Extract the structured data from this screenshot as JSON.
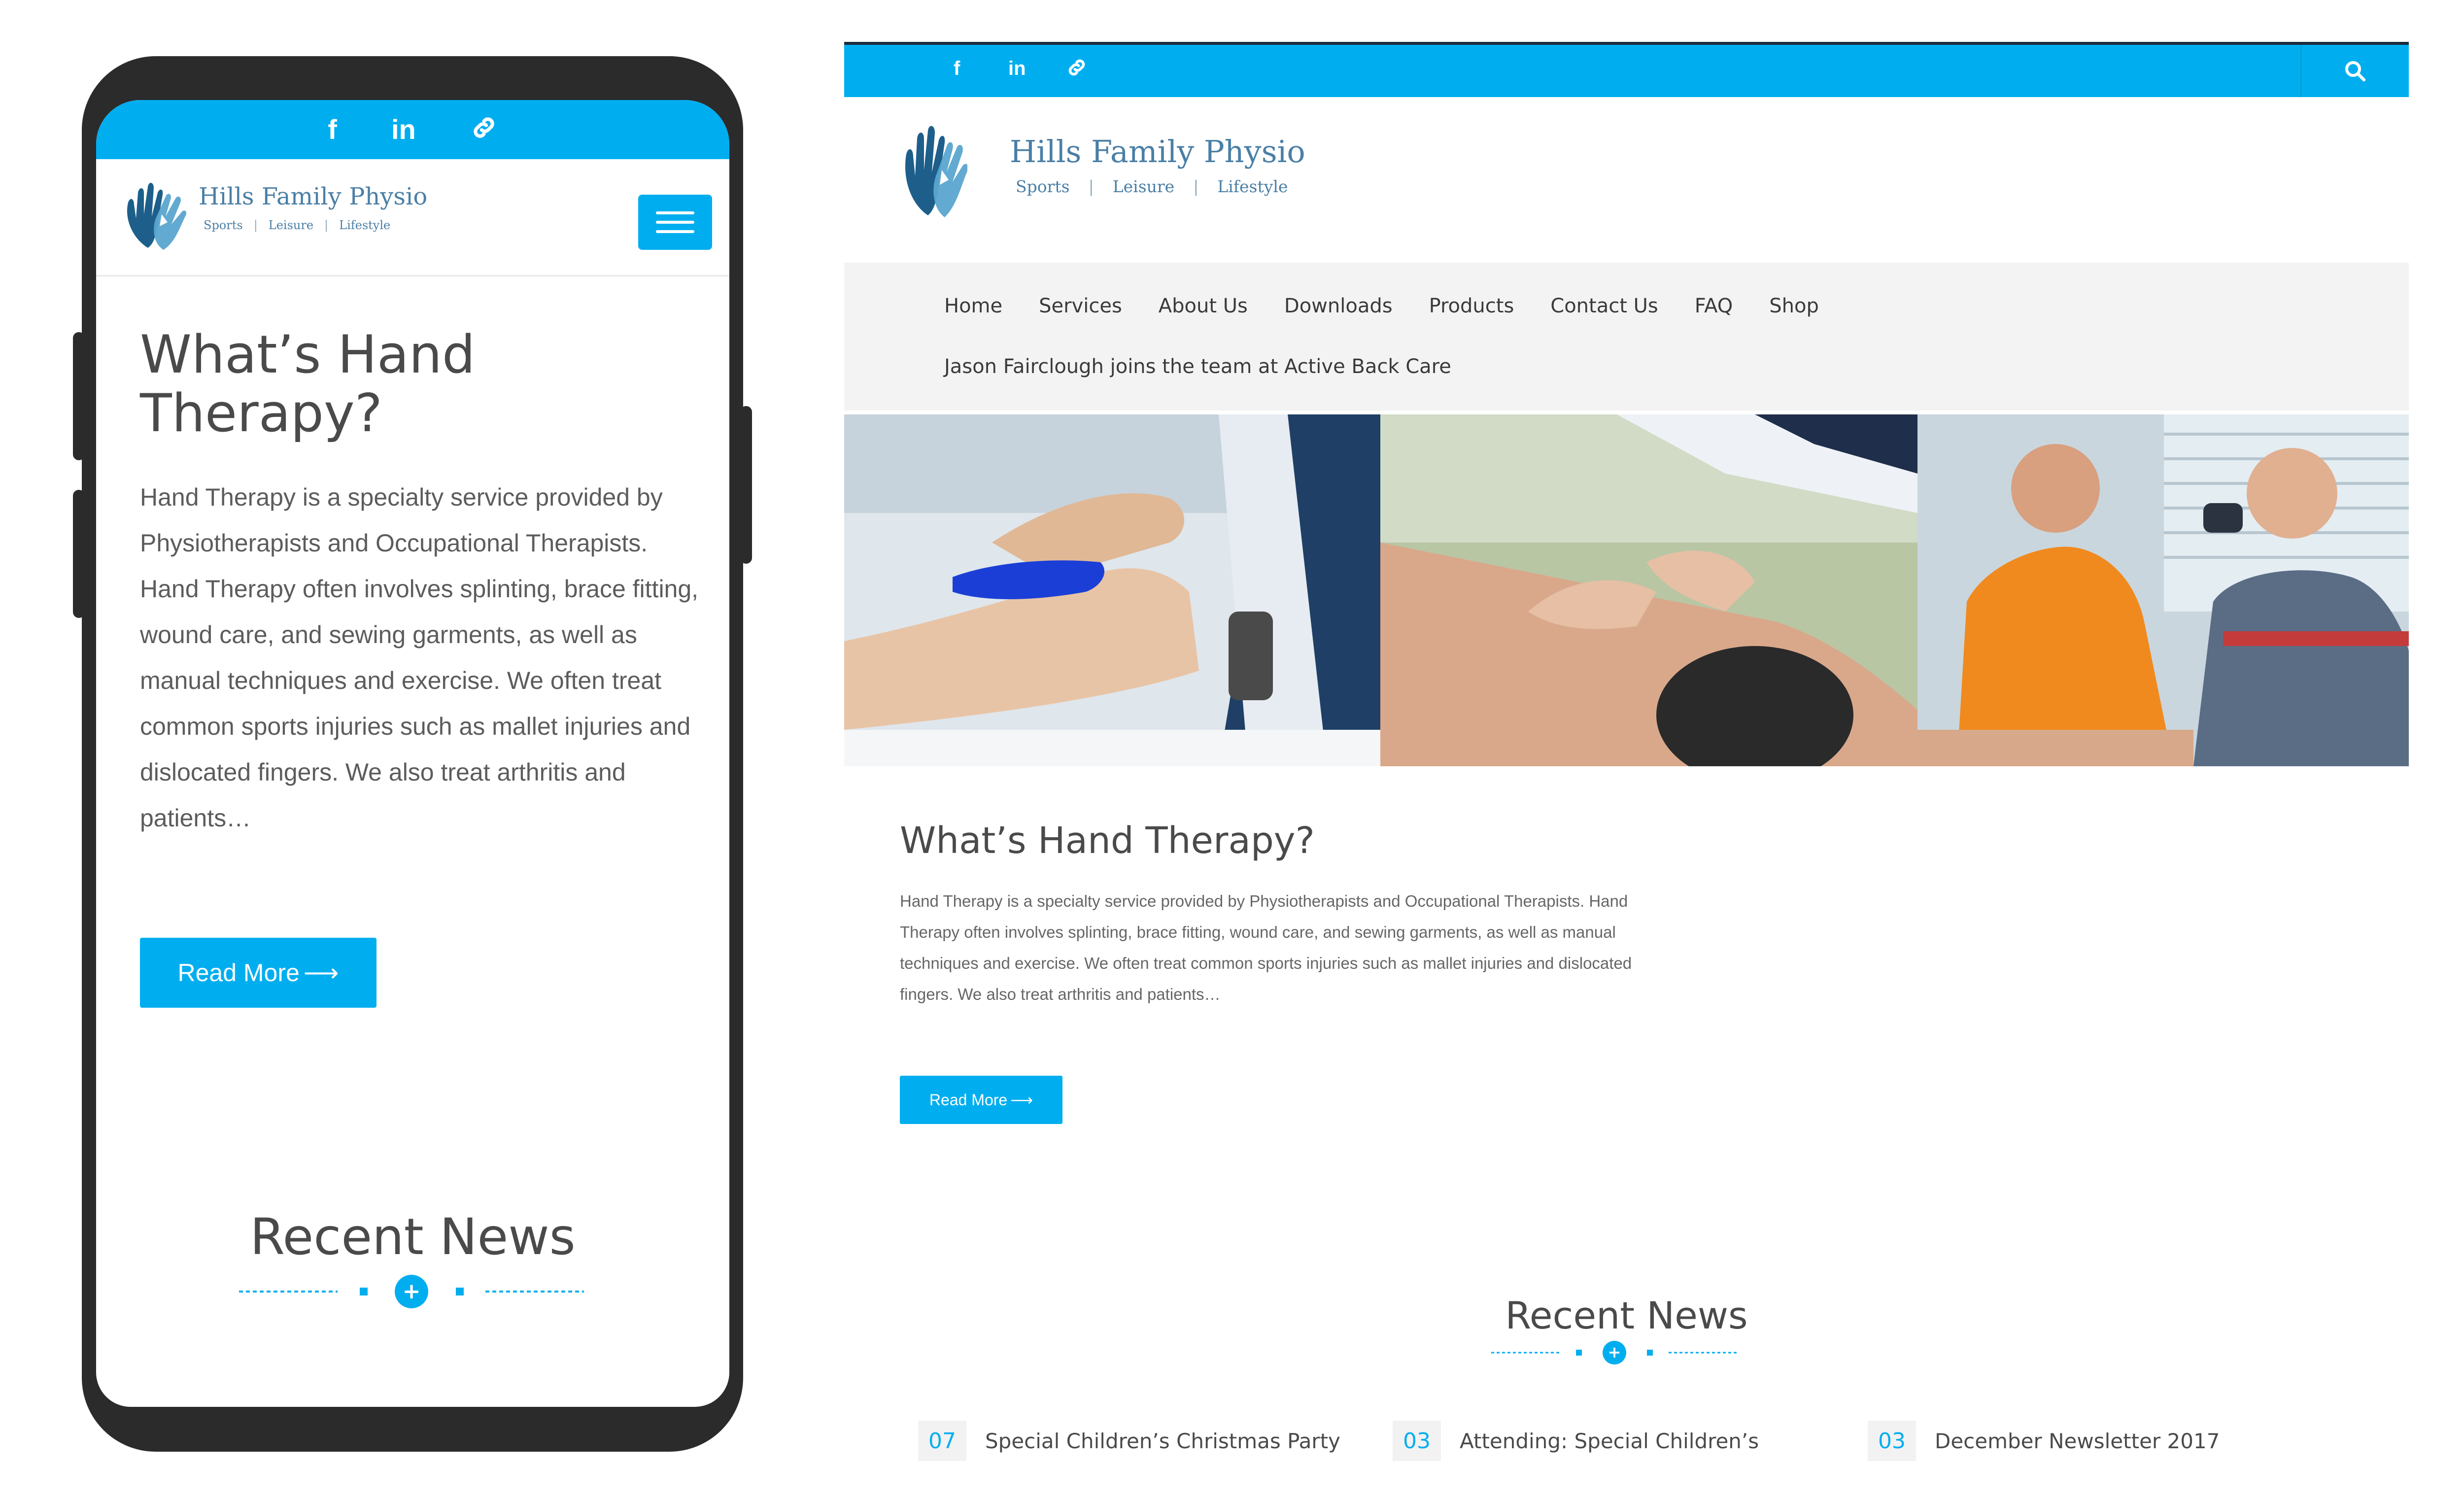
{
  "colors": {
    "accent": "#00aeef",
    "brand_text": "#4a7fa6",
    "heading": "#4a4a4a",
    "phone_frame": "#2b2b2b",
    "nav_bg": "#f3f3f3"
  },
  "social_icons": [
    {
      "name": "facebook-icon",
      "glyph": "f"
    },
    {
      "name": "linkedin-icon",
      "glyph": "in"
    },
    {
      "name": "link-icon",
      "glyph": "link"
    }
  ],
  "brand": {
    "name": "Hills Family Physio",
    "taglines": [
      "Sports",
      "Leisure",
      "Lifestyle"
    ],
    "separator": "|"
  },
  "nav": {
    "items": [
      "Home",
      "Services",
      "About Us",
      "Downloads",
      "Products",
      "Contact Us",
      "FAQ",
      "Shop"
    ],
    "second_row": "Jason Fairclough joins the team at Active Back Care"
  },
  "article": {
    "title": "What’s Hand Therapy?",
    "title_mobile_line1": "What’s Hand",
    "title_mobile_line2": "Therapy?",
    "body": "Hand Therapy is a specialty service provided by Physiotherapists and Occupational Therapists. Hand Therapy often involves splinting, brace fitting, wound care, and sewing garments, as well as manual techniques and exercise. We often treat common sports injuries such as mallet injuries and dislocated fingers. We also treat arthritis and patients…",
    "read_more": "Read More"
  },
  "recent_news": {
    "title": "Recent News",
    "items": [
      {
        "date": "07",
        "title": "Special Children’s Christmas Party"
      },
      {
        "date": "03",
        "title": "Attending: Special Children’s"
      },
      {
        "date": "03",
        "title": "December Newsletter 2017"
      }
    ]
  }
}
